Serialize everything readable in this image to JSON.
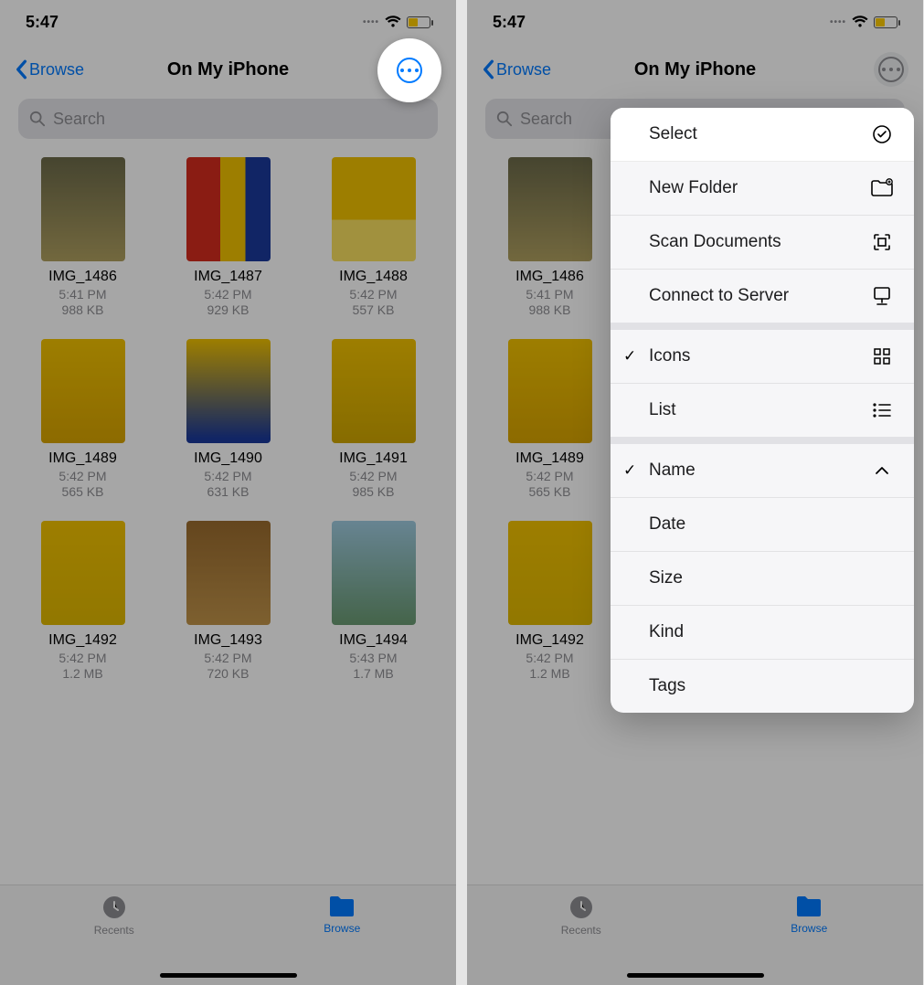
{
  "status": {
    "time": "5:47"
  },
  "nav": {
    "back_label": "Browse",
    "title": "On My iPhone"
  },
  "search": {
    "placeholder": "Search"
  },
  "files": [
    {
      "name": "IMG_1486",
      "time": "5:41 PM",
      "size": "988 KB",
      "thumb": "t1"
    },
    {
      "name": "IMG_1487",
      "time": "5:42 PM",
      "size": "929 KB",
      "thumb": "t2"
    },
    {
      "name": "IMG_1488",
      "time": "5:42 PM",
      "size": "557 KB",
      "thumb": "t3"
    },
    {
      "name": "IMG_1489",
      "time": "5:42 PM",
      "size": "565 KB",
      "thumb": "t4"
    },
    {
      "name": "IMG_1490",
      "time": "5:42 PM",
      "size": "631 KB",
      "thumb": "t5"
    },
    {
      "name": "IMG_1491",
      "time": "5:42 PM",
      "size": "985 KB",
      "thumb": "t6"
    },
    {
      "name": "IMG_1492",
      "time": "5:42 PM",
      "size": "1.2 MB",
      "thumb": "t7"
    },
    {
      "name": "IMG_1493",
      "time": "5:42 PM",
      "size": "720 KB",
      "thumb": "t8"
    },
    {
      "name": "IMG_1494",
      "time": "5:43 PM",
      "size": "1.7 MB",
      "thumb": "t9"
    }
  ],
  "tabs": {
    "recents": "Recents",
    "browse": "Browse"
  },
  "menu": {
    "select": "Select",
    "new_folder": "New Folder",
    "scan_documents": "Scan Documents",
    "connect_to_server": "Connect to Server",
    "icons": "Icons",
    "list": "List",
    "name": "Name",
    "date": "Date",
    "size": "Size",
    "kind": "Kind",
    "tags": "Tags"
  }
}
